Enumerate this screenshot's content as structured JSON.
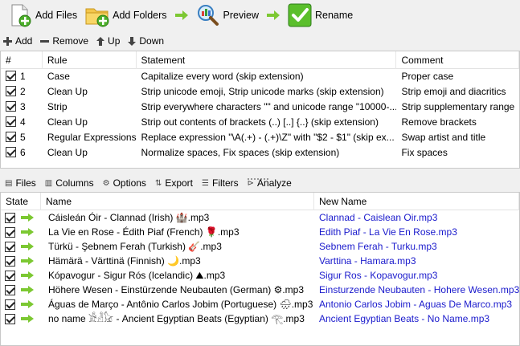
{
  "toolbar": {
    "add_files": "Add Files",
    "add_folders": "Add Folders",
    "preview": "Preview",
    "rename": "Rename"
  },
  "rules_toolbar": {
    "add": "Add",
    "remove": "Remove",
    "up": "Up",
    "down": "Down"
  },
  "rules_table": {
    "headers": {
      "num": "#",
      "rule": "Rule",
      "statement": "Statement",
      "comment": "Comment"
    },
    "rows": [
      {
        "num": "1",
        "rule": "Case",
        "statement": "Capitalize every word (skip extension)",
        "comment": "Proper case"
      },
      {
        "num": "2",
        "rule": "Clean Up",
        "statement": "Strip unicode emoji, Strip unicode marks (skip extension)",
        "comment": "Strip emoji and diacritics"
      },
      {
        "num": "3",
        "rule": "Strip",
        "statement": "Strip everywhere characters \"\" and unicode range \"10000-...",
        "comment": "Strip supplementary range"
      },
      {
        "num": "4",
        "rule": "Clean Up",
        "statement": "Strip out contents of brackets (..)  [..]  {..}  (skip extension)",
        "comment": "Remove brackets"
      },
      {
        "num": "5",
        "rule": "Regular Expressions",
        "statement": "Replace expression \"\\A(.+) - (.+)\\Z\" with \"$2 - $1\" (skip ex...",
        "comment": "Swap artist and title"
      },
      {
        "num": "6",
        "rule": "Clean Up",
        "statement": "Normalize spaces, Fix spaces (skip extension)",
        "comment": "Fix spaces"
      }
    ]
  },
  "files_toolbar": {
    "files": "Files",
    "columns": "Columns",
    "options": "Options",
    "export": "Export",
    "filters": "Filters",
    "analyze": "Analyze"
  },
  "files_table": {
    "headers": {
      "state": "State",
      "name": "Name",
      "new_name": "New Name"
    },
    "rows": [
      {
        "name": "Cáisleán Óir - Clannad (Irish) 🏰.mp3",
        "new_name": "Clannad - Caislean Oir.mp3"
      },
      {
        "name": "La Vie en Rose - Édith Piaf (French) 🌹.mp3",
        "new_name": "Edith Piaf - La Vie En Rose.mp3"
      },
      {
        "name": "Türkü - Şebnem Ferah (Turkish) 🎸.mp3",
        "new_name": "Sebnem Ferah - Turku.mp3"
      },
      {
        "name": "Hämärä - Värttinä (Finnish) 🌙.mp3",
        "new_name": "Varttina - Hamara.mp3"
      },
      {
        "name": "Kópavogur - Sigur Rós (Icelandic) ⛰.mp3",
        "new_name": "Sigur Ros - Kopavogur.mp3"
      },
      {
        "name": "Höhere Wesen - Einstürzende Neubauten (German) ⚙.mp3",
        "new_name": "Einsturzende Neubauten - Hohere Wesen.mp3"
      },
      {
        "name": "Águas de Março - Antônio Carlos Jobim (Portuguese) 🌧.mp3",
        "new_name": "Antonio Carlos Jobim - Aguas De Marco.mp3"
      },
      {
        "name": "no name 𓀀𓁐𓃠 - Ancient Egyptian Beats (Egyptian) 𓂀.mp3",
        "new_name": "Ancient Egyptian Beats - No Name.mp3"
      }
    ]
  },
  "colors": {
    "new_name_link": "#1a1acc",
    "accent_green": "#5bbf2c"
  }
}
